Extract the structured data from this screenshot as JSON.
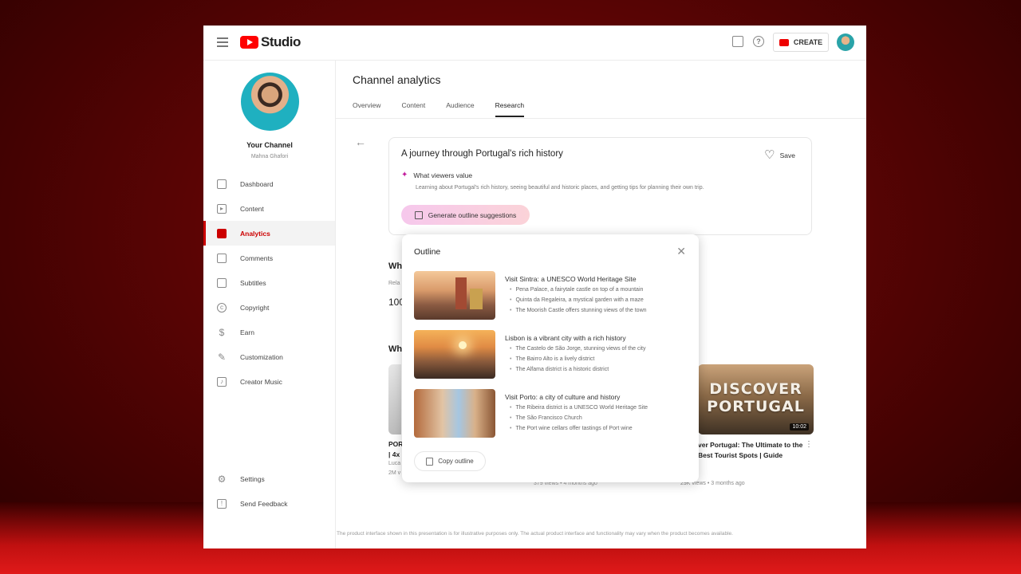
{
  "app": {
    "logo_text": "Studio",
    "create_label": "CREATE"
  },
  "sidebar": {
    "channel_name": "Your Channel",
    "channel_handle": "Mahna Ghafori",
    "items": [
      {
        "label": "Dashboard",
        "icon": "dashboard-icon"
      },
      {
        "label": "Content",
        "icon": "content-icon"
      },
      {
        "label": "Analytics",
        "icon": "analytics-icon"
      },
      {
        "label": "Comments",
        "icon": "comments-icon"
      },
      {
        "label": "Subtitles",
        "icon": "subtitles-icon"
      },
      {
        "label": "Copyright",
        "icon": "copyright-icon"
      },
      {
        "label": "Earn",
        "icon": "earn-icon"
      },
      {
        "label": "Customization",
        "icon": "customization-icon"
      },
      {
        "label": "Creator Music",
        "icon": "music-icon"
      }
    ],
    "bottom": [
      {
        "label": "Settings",
        "icon": "settings-icon"
      },
      {
        "label": "Send Feedback",
        "icon": "feedback-icon"
      }
    ]
  },
  "main": {
    "title": "Channel analytics",
    "tabs": [
      "Overview",
      "Content",
      "Audience",
      "Research"
    ],
    "active_tab": "Research"
  },
  "topic": {
    "title": "A journey through Portugal's rich history",
    "save_label": "Save",
    "values_label": "What viewers value",
    "values_desc": "Learning about Portugal's rich history, seeing beautiful and historic places, and getting tips for planning their own trip.",
    "generate_label": "Generate outline suggestions"
  },
  "background": {
    "heading1": "Wh",
    "small1": "Rela",
    "number1": "100",
    "heading2": "Wh",
    "left_card": [
      "POR",
      "| 4x",
      "Luca",
      "2M v"
    ],
    "mid_meta": "379 views • 4 months ago",
    "video": {
      "thumb_text_1": "DISCOVER",
      "thumb_text_2": "PORTUGAL",
      "duration": "10:02",
      "title": "ver Portugal: The Ultimate to the Best Tourist Spots | Guide",
      "channel": "Guide",
      "meta": "29K views • 3 months ago"
    }
  },
  "outline": {
    "title": "Outline",
    "copy_label": "Copy outline",
    "items": [
      {
        "heading": "Visit Sintra: a UNESCO World Heritage Site",
        "bullets": [
          "Pena Palace, a fairytale castle on top of a mountain",
          "Quinta da Regaleira, a mystical garden with a maze",
          "The Moorish Castle offers stunning views of the town"
        ]
      },
      {
        "heading": "Lisbon is a vibrant city with a rich history",
        "bullets": [
          "The Castelo de São Jorge, stunning views of the city",
          "The Bairro Alto is a lively district",
          "The Alfama district is a historic district"
        ]
      },
      {
        "heading": "Visit Porto: a city of culture and history",
        "bullets": [
          "The Ribeira district is a UNESCO World Heritage Site",
          "The São Francisco Church",
          "The Port wine cellars offer tastings of Port wine"
        ]
      }
    ]
  },
  "footer": "The product interface shown in this presentation is for illustrative purposes only. The actual product interface and functionality may vary when the product becomes available."
}
